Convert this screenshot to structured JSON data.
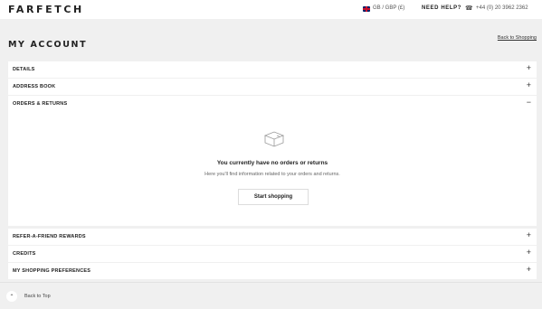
{
  "header": {
    "logo": "FARFETCH",
    "region": "GB / GBP (£)",
    "help": "NEED HELP?",
    "phone": "+44 (0) 20 3962 2362"
  },
  "page": {
    "title": "MY ACCOUNT",
    "back_to_shopping": "Back to Shopping"
  },
  "sections": {
    "details": {
      "label": "DETAILS",
      "sign": "+"
    },
    "address": {
      "label": "ADDRESS BOOK",
      "sign": "+"
    },
    "orders": {
      "label": "ORDERS & RETURNS",
      "sign": "−"
    },
    "refer": {
      "label": "REFER-A-FRIEND REWARDS",
      "sign": "+"
    },
    "credits": {
      "label": "CREDITS",
      "sign": "+"
    },
    "prefs": {
      "label": "MY SHOPPING PREFERENCES",
      "sign": "+"
    }
  },
  "orders_panel": {
    "empty_title": "You currently have no orders or returns",
    "empty_subtitle": "Here you'll find information related to your orders and returns.",
    "cta": "Start shopping"
  },
  "footer": {
    "back_to_top": "Back to Top"
  }
}
